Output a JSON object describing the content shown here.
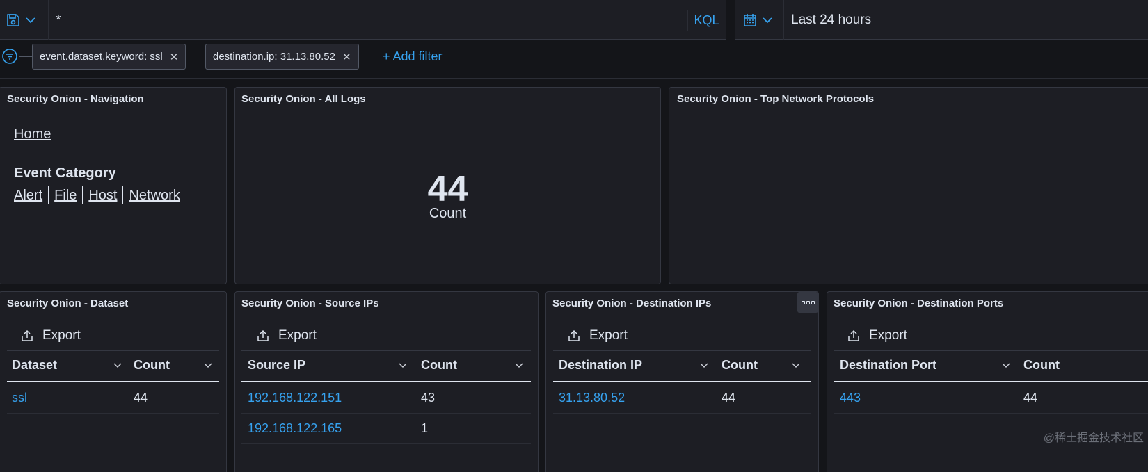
{
  "query": {
    "value": "*",
    "language": "KQL"
  },
  "time": {
    "range": "Last 24 hours"
  },
  "filters": [
    {
      "label": "event.dataset.keyword: ssl"
    },
    {
      "label": "destination.ip: 31.13.80.52"
    }
  ],
  "add_filter_label": "+ Add filter",
  "panels": {
    "navigation": {
      "title": "Security Onion - Navigation",
      "home": "Home",
      "heading": "Event Category",
      "links": [
        "Alert",
        "File",
        "Host",
        "Network"
      ]
    },
    "all_logs": {
      "title": "Security Onion - All Logs",
      "value": "44",
      "label": "Count"
    },
    "protocols": {
      "title": "Security Onion - Top Network Protocols"
    },
    "dataset": {
      "title": "Security Onion - Dataset",
      "export": "Export",
      "columns": [
        "Dataset",
        "Count"
      ],
      "rows": [
        [
          "ssl",
          "44"
        ]
      ]
    },
    "source_ips": {
      "title": "Security Onion - Source IPs",
      "export": "Export",
      "columns": [
        "Source IP",
        "Count"
      ],
      "rows": [
        [
          "192.168.122.151",
          "43"
        ],
        [
          "192.168.122.165",
          "1"
        ]
      ]
    },
    "destination_ips": {
      "title": "Security Onion - Destination IPs",
      "export": "Export",
      "columns": [
        "Destination IP",
        "Count"
      ],
      "rows": [
        [
          "31.13.80.52",
          "44"
        ]
      ]
    },
    "destination_ports": {
      "title": "Security Onion - Destination Ports",
      "export": "Export",
      "columns": [
        "Destination Port",
        "Count"
      ],
      "rows": [
        [
          "443",
          "44"
        ]
      ]
    }
  },
  "watermark": "@稀土掘金技术社区",
  "colors": {
    "background": "#141519",
    "panel": "#1d1e24",
    "link": "#36a2ef",
    "text": "#dfe5ef"
  }
}
